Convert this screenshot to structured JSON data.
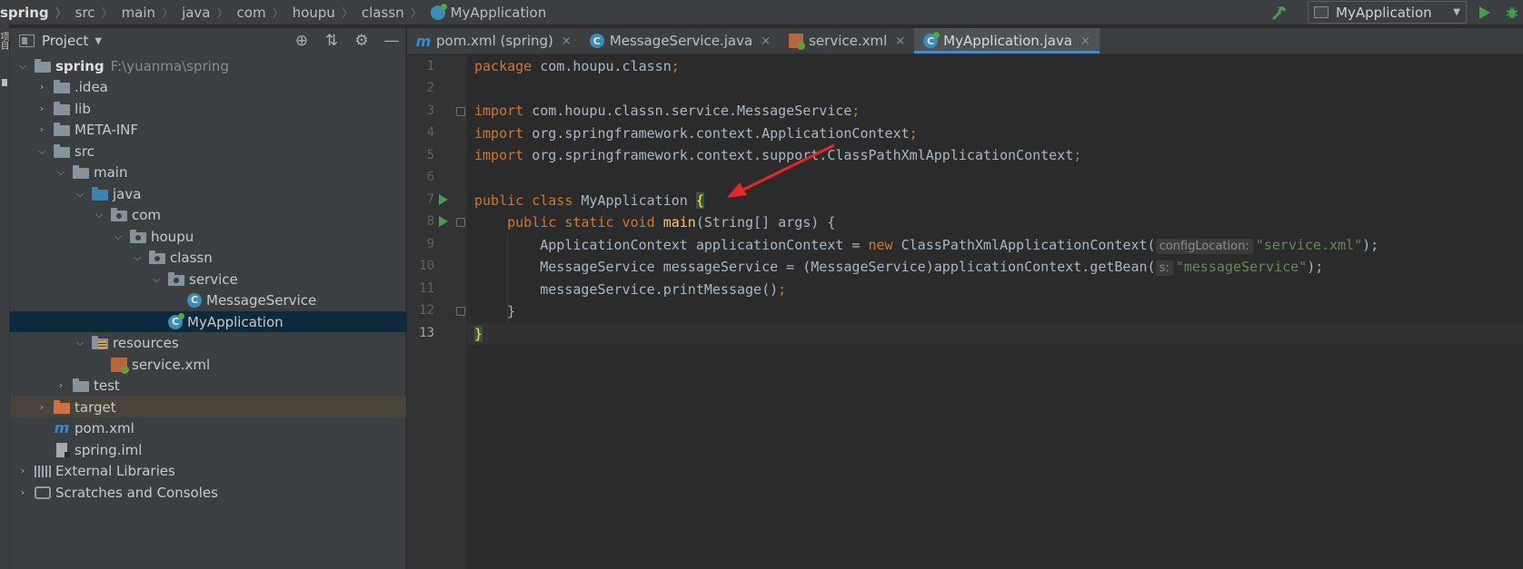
{
  "breadcrumbs": [
    "spring",
    "src",
    "main",
    "java",
    "com",
    "houpu",
    "classn",
    "MyApplication"
  ],
  "run_config": {
    "label": "MyApplication"
  },
  "left_strip": {
    "label": "项目"
  },
  "project_panel": {
    "title": "Project"
  },
  "tree": [
    {
      "label": "spring",
      "path": "F:\\yuanma\\spring"
    },
    {
      "label": ".idea"
    },
    {
      "label": "lib"
    },
    {
      "label": "META-INF"
    },
    {
      "label": "src"
    },
    {
      "label": "main"
    },
    {
      "label": "java"
    },
    {
      "label": "com"
    },
    {
      "label": "houpu"
    },
    {
      "label": "classn"
    },
    {
      "label": "service"
    },
    {
      "label": "MessageService"
    },
    {
      "label": "MyApplication"
    },
    {
      "label": "resources"
    },
    {
      "label": "service.xml"
    },
    {
      "label": "test"
    },
    {
      "label": "target"
    },
    {
      "label": "pom.xml"
    },
    {
      "label": "spring.iml"
    },
    {
      "label": "External Libraries"
    },
    {
      "label": "Scratches and Consoles"
    }
  ],
  "tabs": [
    {
      "label": "pom.xml (spring)",
      "close": "×"
    },
    {
      "label": "MessageService.java",
      "close": "×"
    },
    {
      "label": "service.xml",
      "close": "×"
    },
    {
      "label": "MyApplication.java",
      "close": "×"
    }
  ],
  "line_numbers": [
    "1",
    "2",
    "3",
    "4",
    "5",
    "6",
    "7",
    "8",
    "9",
    "10",
    "11",
    "12",
    "13"
  ],
  "code": {
    "l1_kw": "package",
    "l1_rest": " com.houpu.classn",
    "l1_semi": ";",
    "l3_kw": "import",
    "l3_rest": " com.houpu.classn.service.MessageService",
    "l3_semi": ";",
    "l4_kw": "import",
    "l4_rest": " org.springframework.context.ApplicationContext",
    "l4_semi": ";",
    "l5_kw": "import",
    "l5_rest": " org.springframework.context.support.ClassPathXmlApplicationContext",
    "l5_semi": ";",
    "l7_kw": "public class",
    "l7_name": " MyApplication ",
    "l7_brace": "{",
    "l8_kw": "    public static void",
    "l8_fn": " main",
    "l8_rest": "(String[] args) {",
    "l9_a": "        ApplicationContext applicationContext = ",
    "l9_kw": "new",
    "l9_b": " ClassPathXmlApplicationContext(",
    "l9_hint": "configLocation:",
    "l9_str": "\"service.xml\"",
    "l9_end": ");",
    "l10_a": "        MessageService messageService = (MessageService)applicationContext.getBean(",
    "l10_hint": "s:",
    "l10_str": "\"messageService\"",
    "l10_end": ");",
    "l11_a": "        messageService.printMessage()",
    "l11_semi": ";",
    "l12": "    }",
    "l13": "}"
  }
}
